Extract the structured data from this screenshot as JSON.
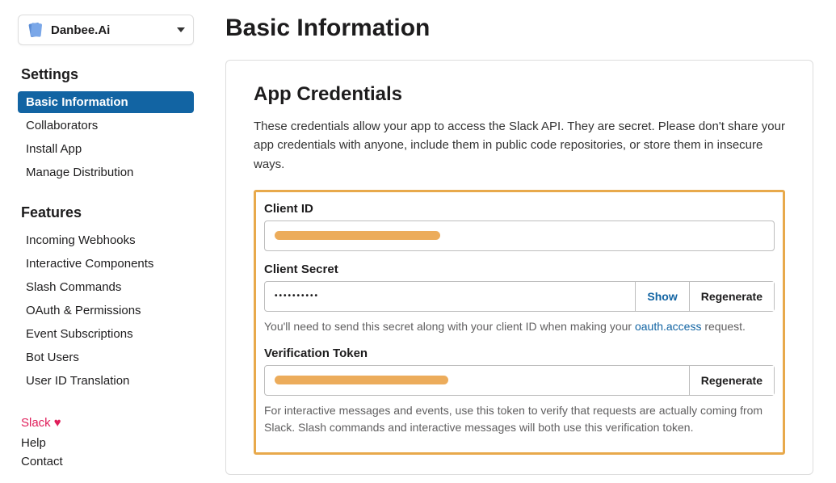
{
  "app_selector": {
    "name": "Danbee.Ai"
  },
  "sidebar": {
    "sections": [
      {
        "title": "Settings",
        "items": [
          {
            "label": "Basic Information",
            "active": true
          },
          {
            "label": "Collaborators"
          },
          {
            "label": "Install App"
          },
          {
            "label": "Manage Distribution"
          }
        ]
      },
      {
        "title": "Features",
        "items": [
          {
            "label": "Incoming Webhooks"
          },
          {
            "label": "Interactive Components"
          },
          {
            "label": "Slash Commands"
          },
          {
            "label": "OAuth & Permissions"
          },
          {
            "label": "Event Subscriptions"
          },
          {
            "label": "Bot Users"
          },
          {
            "label": "User ID Translation"
          }
        ]
      }
    ],
    "footer": {
      "slack": "Slack",
      "help": "Help",
      "contact": "Contact"
    }
  },
  "page": {
    "title": "Basic Information",
    "credentials": {
      "heading": "App Credentials",
      "description": "These credentials allow your app to access the Slack API. They are secret. Please don't share your app credentials with anyone, include them in public code repositories, or store them in insecure ways.",
      "client_id": {
        "label": "Client ID",
        "value_redacted": true
      },
      "client_secret": {
        "label": "Client Secret",
        "masked_value": "••••••••••",
        "show_label": "Show",
        "regenerate_label": "Regenerate",
        "helper_pre": "You'll need to send this secret along with your client ID when making your ",
        "helper_link": "oauth.access",
        "helper_post": " request."
      },
      "verification_token": {
        "label": "Verification Token",
        "value_redacted": true,
        "regenerate_label": "Regenerate",
        "helper": "For interactive messages and events, use this token to verify that requests are actually coming from Slack. Slash commands and interactive messages will both use this verification token."
      }
    }
  }
}
